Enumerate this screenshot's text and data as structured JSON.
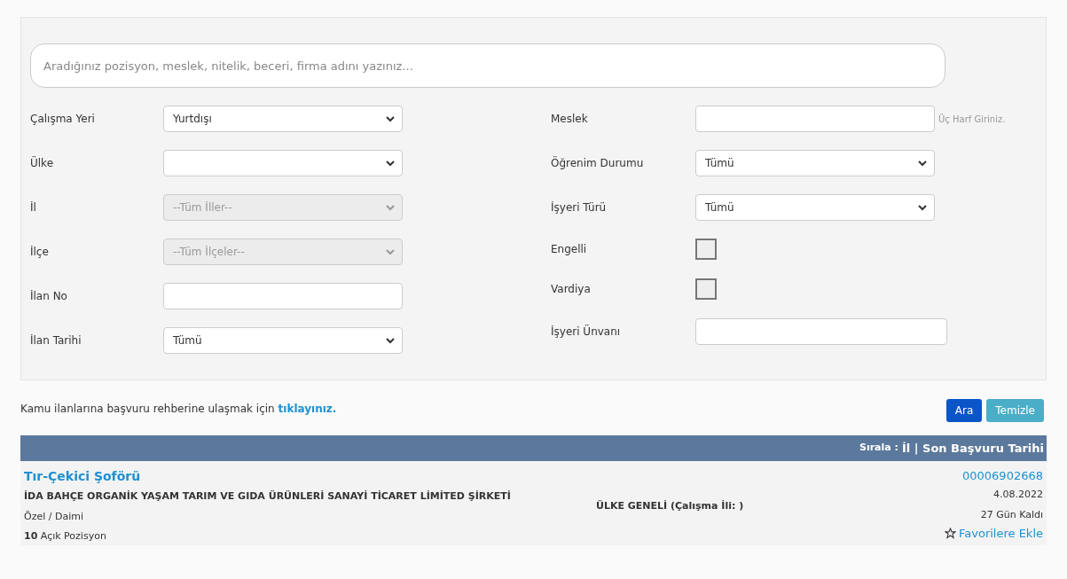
{
  "search": {
    "placeholder": "Aradığınız pozisyon, meslek, nitelik, beceri, firma adını yazınız..."
  },
  "left_fields": [
    {
      "label": "Çalışma Yeri",
      "kind": "select",
      "value": "Yurtdışı"
    },
    {
      "label": "Ülke",
      "kind": "select"
    },
    {
      "label": "İl",
      "kind": "select",
      "value": "--Tüm İller--",
      "disabled": true
    },
    {
      "label": "İlçe",
      "kind": "select",
      "value": "--Tüm İlçeler--",
      "disabled": true
    },
    {
      "label": "İlan No",
      "kind": "input"
    },
    {
      "label": "İlan Tarihi",
      "kind": "select",
      "value": "Tümü"
    }
  ],
  "right_fields": [
    {
      "label": "Meslek",
      "kind": "input",
      "hint": "Üç Harf Giriniz."
    },
    {
      "label": "Öğrenim Durumu",
      "kind": "select",
      "value": "Tümü"
    },
    {
      "label": "İşyeri Türü",
      "kind": "select",
      "value": "Tümü"
    },
    {
      "label": "Engelli",
      "kind": "checkbox",
      "checked": false
    },
    {
      "label": "Vardiya",
      "kind": "checkbox",
      "checked": false
    },
    {
      "label": "İşyeri Ünvanı",
      "kind": "wide_input"
    }
  ],
  "guide": {
    "text": "Kamu ilanlarına başvuru rehberine ulaşmak için",
    "link": "tıklayınız."
  },
  "buttons": [
    {
      "label": "Ara",
      "kind": "primary"
    },
    {
      "label": "Temizle",
      "kind": "secondary"
    }
  ],
  "sort_bar": {
    "label": "Sırala :",
    "options": "İl | Son Başvuru Tarihi"
  },
  "listings": [
    {
      "title": "Tır-Çekici Şoförü",
      "company": "İDA BAHÇE ORGANİK YAŞAM TARIM VE GIDA ÜRÜNLERİ SANAYİ TİCARET LİMİTED ŞİRKETİ",
      "type": "Özel / Daimi",
      "positions": "**10** Açık Pozisyon",
      "location": "ÜLKE GENELİ (Çalışma İli: )",
      "number": "00006902668",
      "date": "4.08.2022",
      "remaining": "27 Gün Kaldı",
      "favorite": "Favorilere Ekle"
    }
  ]
}
